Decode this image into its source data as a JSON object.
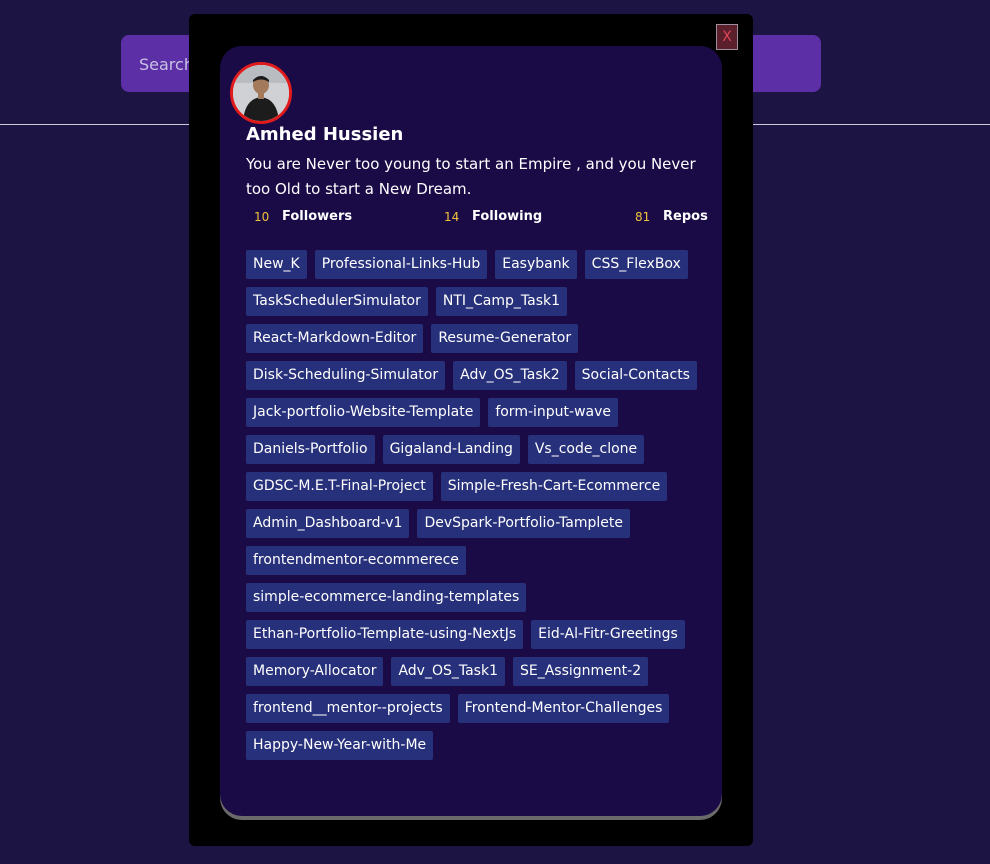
{
  "search": {
    "placeholder": "Search"
  },
  "modal": {
    "close_label": "X",
    "user": {
      "name": "Amhed Hussien",
      "bio": "You are Never too young to start an Empire , and you Never too Old to start a New Dream."
    },
    "stats": {
      "followers": {
        "count": "10",
        "label": "Followers"
      },
      "following": {
        "count": "14",
        "label": "Following"
      },
      "repos": {
        "count": "81",
        "label": "Repos"
      }
    },
    "repos": [
      "New_K",
      "Professional-Links-Hub",
      "Easybank",
      "CSS_FlexBox",
      "TaskSchedulerSimulator",
      "NTI_Camp_Task1",
      "React-Markdown-Editor",
      "Resume-Generator",
      "Disk-Scheduling-Simulator",
      "Adv_OS_Task2",
      "Social-Contacts",
      "Jack-portfolio-Website-Template",
      "form-input-wave",
      "Daniels-Portfolio",
      "Gigaland-Landing",
      "Vs_code_clone",
      "GDSC-M.E.T-Final-Project",
      "Simple-Fresh-Cart-Ecommerce",
      "Admin_Dashboard-v1",
      "DevSpark-Portfolio-Tamplete",
      "frontendmentor-ecommerece",
      "simple-ecommerce-landing-templates",
      "Ethan-Portfolio-Template-using-NextJs",
      "Eid-Al-Fitr-Greetings",
      "Memory-Allocator",
      "Adv_OS_Task1",
      "SE_Assignment-2",
      "frontend__mentor--projects",
      "Frontend-Mentor-Challenges",
      "Happy-New-Year-with-Me"
    ]
  }
}
